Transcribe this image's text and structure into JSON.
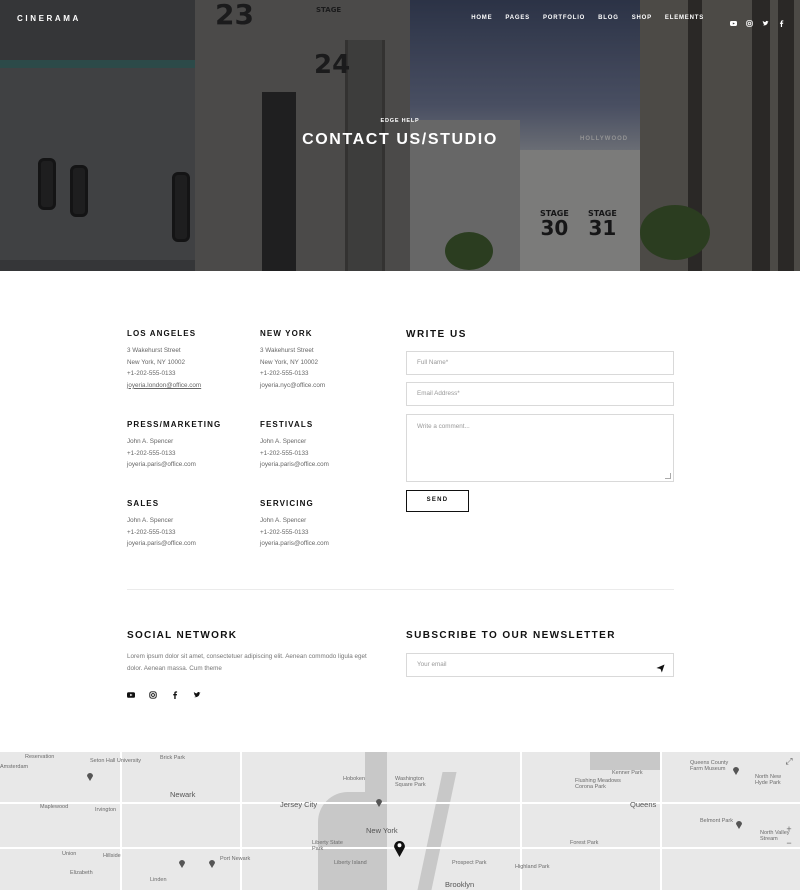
{
  "nav": {
    "logo": "CINERAMA",
    "menu": [
      "HOME",
      "PAGES",
      "PORTFOLIO",
      "BLOG",
      "SHOP",
      "ELEMENTS"
    ],
    "social_icons": [
      "youtube-icon",
      "instagram-icon",
      "twitter-icon",
      "facebook-icon"
    ]
  },
  "hero": {
    "subtitle": "EDGE HELP",
    "title": "CONTACT US/STUDIO",
    "stage_labels": [
      {
        "word": "STAGE",
        "num": "30"
      },
      {
        "word": "STAGE",
        "num": "31"
      }
    ],
    "building_numbers": [
      "23",
      "24"
    ],
    "building_stage_word": "STAGE",
    "sign": "HOLLYWOOD"
  },
  "offices": [
    {
      "title": "LOS ANGELES",
      "lines": [
        "3 Wakehurst Street",
        "New York, NY 10002",
        "+1-202-555-0133"
      ],
      "email": "joyeria.london@office.com"
    },
    {
      "title": "NEW YORK",
      "lines": [
        "3 Wakehurst Street",
        "New York, NY 10002",
        "+1-202-555-0133"
      ],
      "email": "joyeria.nyc@office.com"
    },
    {
      "title": "PRESS/MARKETING",
      "lines": [
        "John A. Spencer",
        "+1-202-555-0133"
      ],
      "email": "joyeria.paris@office.com"
    },
    {
      "title": "FESTIVALS",
      "lines": [
        "John A. Spencer",
        "+1-202-555-0133"
      ],
      "email": "joyeria.paris@office.com"
    },
    {
      "title": "SALES",
      "lines": [
        "John A. Spencer",
        "+1-202-555-0133"
      ],
      "email": "joyeria.paris@office.com"
    },
    {
      "title": "SERVICING",
      "lines": [
        "John A. Spencer",
        "+1-202-555-0133"
      ],
      "email": "joyeria.paris@office.com"
    }
  ],
  "contact_form": {
    "title": "WRITE US",
    "name_placeholder": "Full Name*",
    "email_placeholder": "Email Address*",
    "comment_placeholder": "Write a comment...",
    "send_label": "SEND"
  },
  "social": {
    "title": "SOCIAL NETWORK",
    "text": "Lorem ipsum dolor sit amet, consectetuer adipiscing elit. Aenean commodo ligula eget dolor. Aenean massa. Cum theme",
    "icons": [
      "youtube-icon",
      "instagram-icon",
      "facebook-icon",
      "twitter-icon"
    ]
  },
  "newsletter": {
    "title": "SUBSCRIBE TO OUR NEWSLETTER",
    "placeholder": "Your email",
    "submit_icon": "paper-plane-icon"
  },
  "map": {
    "labels": [
      "Reservation",
      "Seton Hall University",
      "Brick Park",
      "Maplewood",
      "Irvington",
      "Newark",
      "Jersey City",
      "Hoboken",
      "Washington Square Park",
      "Flushing Meadows Corona Park",
      "Queens County Farm Museum",
      "North New Hyde Park",
      "New York",
      "Union",
      "Hillside",
      "Port Newark",
      "Liberty State Park",
      "Liberty Island",
      "Prospect Park",
      "Highland Park",
      "Queens",
      "Brooklyn",
      "Belmont Park",
      "North Valley Stream",
      "Linden",
      "Forest Park",
      "Elizabeth",
      "Kenner Park",
      "Amsterdam"
    ],
    "controls": [
      "⤢",
      "+",
      "−"
    ]
  },
  "colors": {
    "accent": "#111111",
    "muted": "#666666",
    "border": "#d9d9d9",
    "map_bg": "#e8e8e8"
  }
}
